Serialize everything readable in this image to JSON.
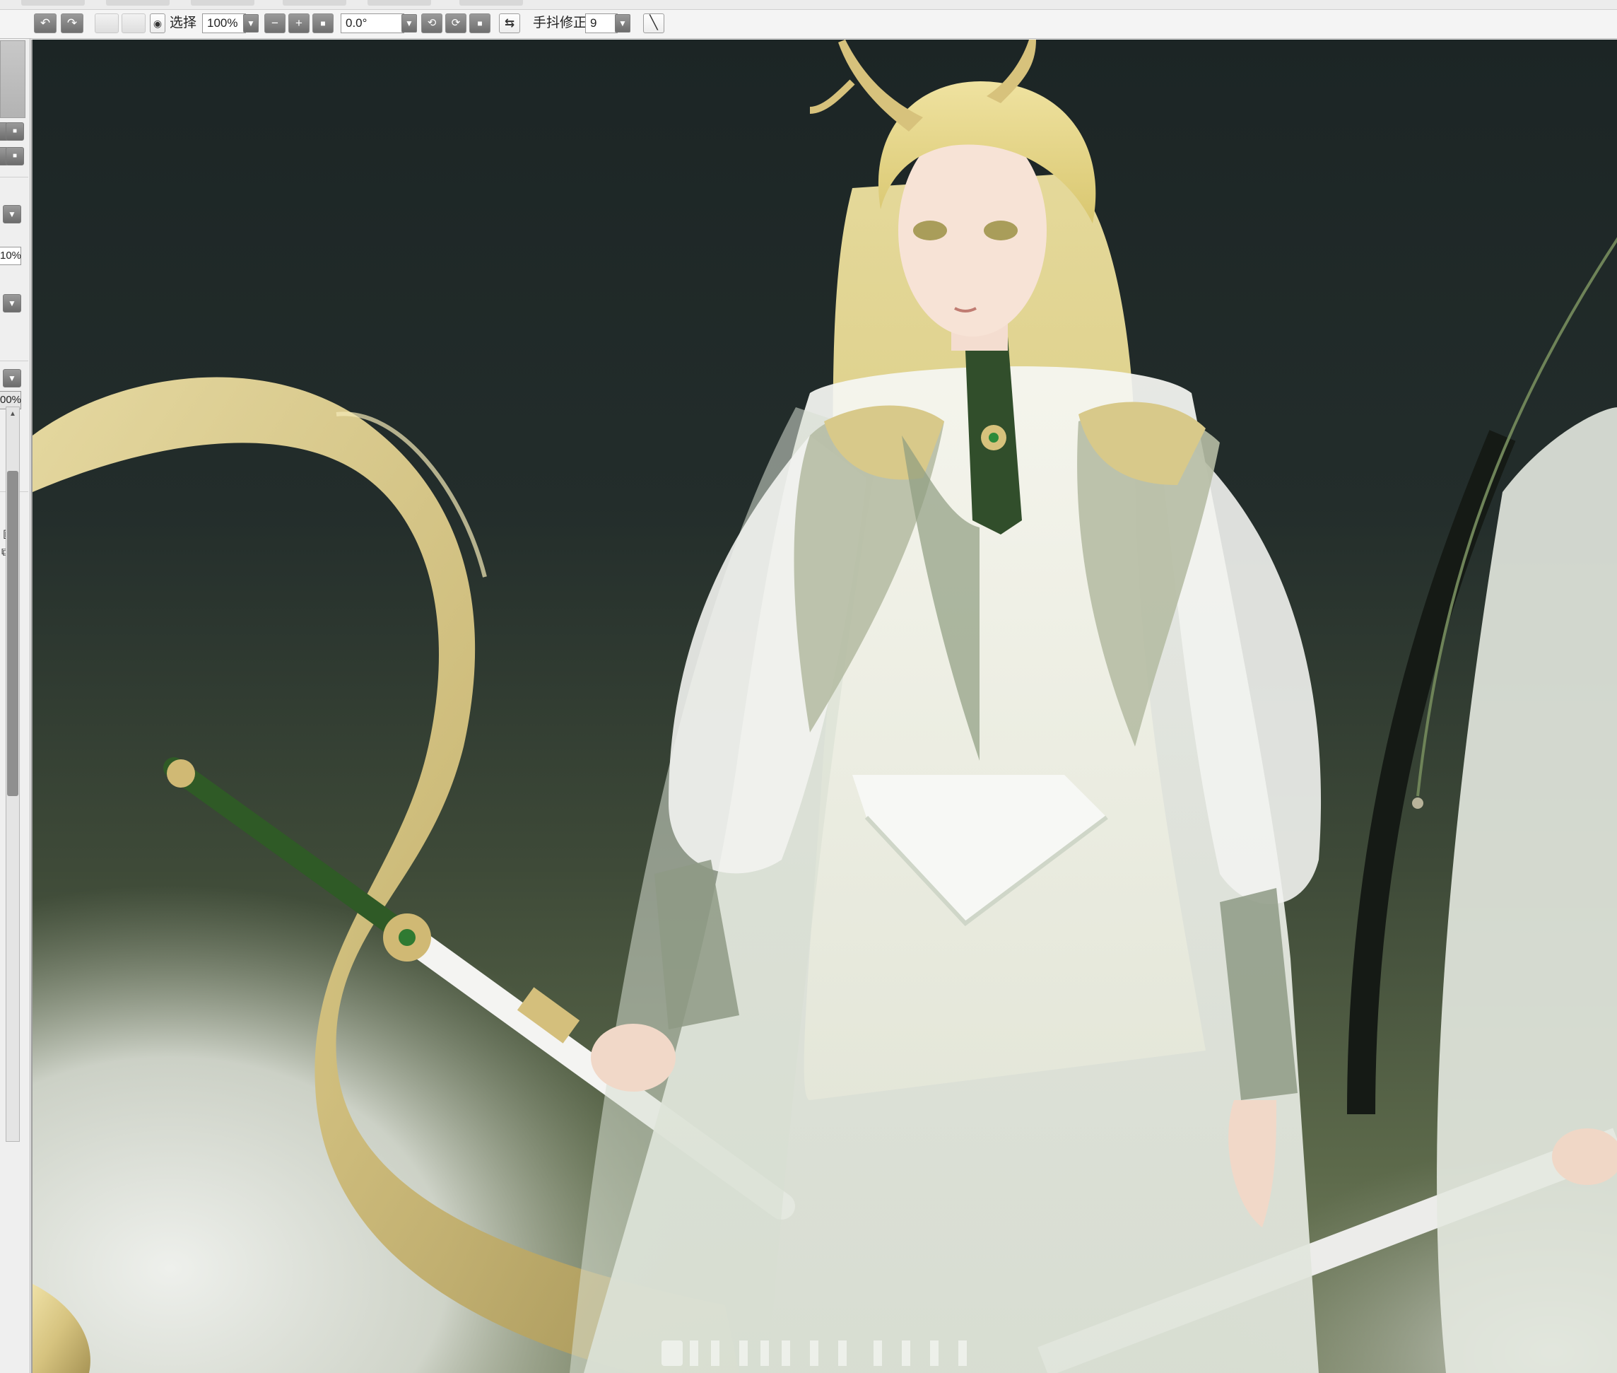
{
  "toolbar": {
    "undo_icon": "undo-icon",
    "redo_icon": "redo-icon",
    "select_label": "选择",
    "zoom_value": "100%",
    "rotation_value": "0.0°",
    "stabilizer_label": "手抖修正",
    "stabilizer_value": "9"
  },
  "left_panel": {
    "opacity_value_1": "10%",
    "opacity_value_2": "00%"
  },
  "canvas": {
    "description_colors": {
      "background_top": "#1e2727",
      "background_bottom": "#6b7650",
      "mist": "#e9ece6",
      "dragon_gold": "#d8c98a",
      "robe_white": "#eef0ea",
      "jade_green": "#3f6a32"
    }
  }
}
